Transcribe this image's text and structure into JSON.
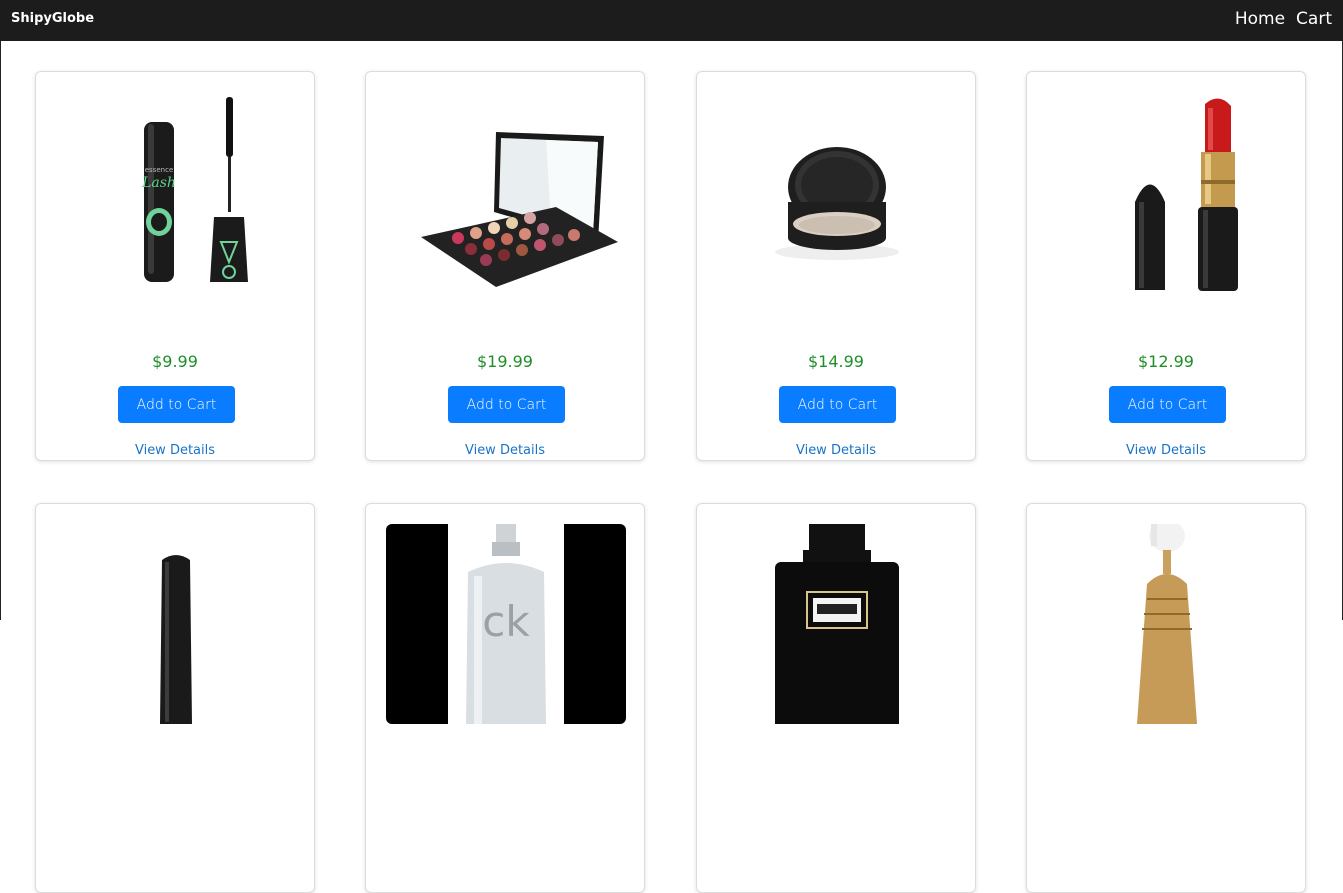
{
  "navbar": {
    "brand": "ShipyGlobe",
    "links": [
      {
        "label": "Home"
      },
      {
        "label": "Cart"
      }
    ]
  },
  "products": [
    {
      "image": "mascara-image",
      "price": "$9.99",
      "add_label": "Add to Cart",
      "details_label": "View Details"
    },
    {
      "image": "eyeshadow-palette-image",
      "price": "$19.99",
      "add_label": "Add to Cart",
      "details_label": "View Details"
    },
    {
      "image": "compact-powder-image",
      "price": "$14.99",
      "add_label": "Add to Cart",
      "details_label": "View Details"
    },
    {
      "image": "lipstick-image",
      "price": "$12.99",
      "add_label": "Add to Cart",
      "details_label": "View Details"
    },
    {
      "image": "nail-polish-image"
    },
    {
      "image": "ck-one-perfume-image"
    },
    {
      "image": "coco-perfume-image"
    },
    {
      "image": "gold-perfume-image"
    }
  ],
  "colors": {
    "navbar": "#1c1c1c",
    "price": "#1f8f2a",
    "button": "#0a7cff",
    "link": "#1a73c7"
  }
}
